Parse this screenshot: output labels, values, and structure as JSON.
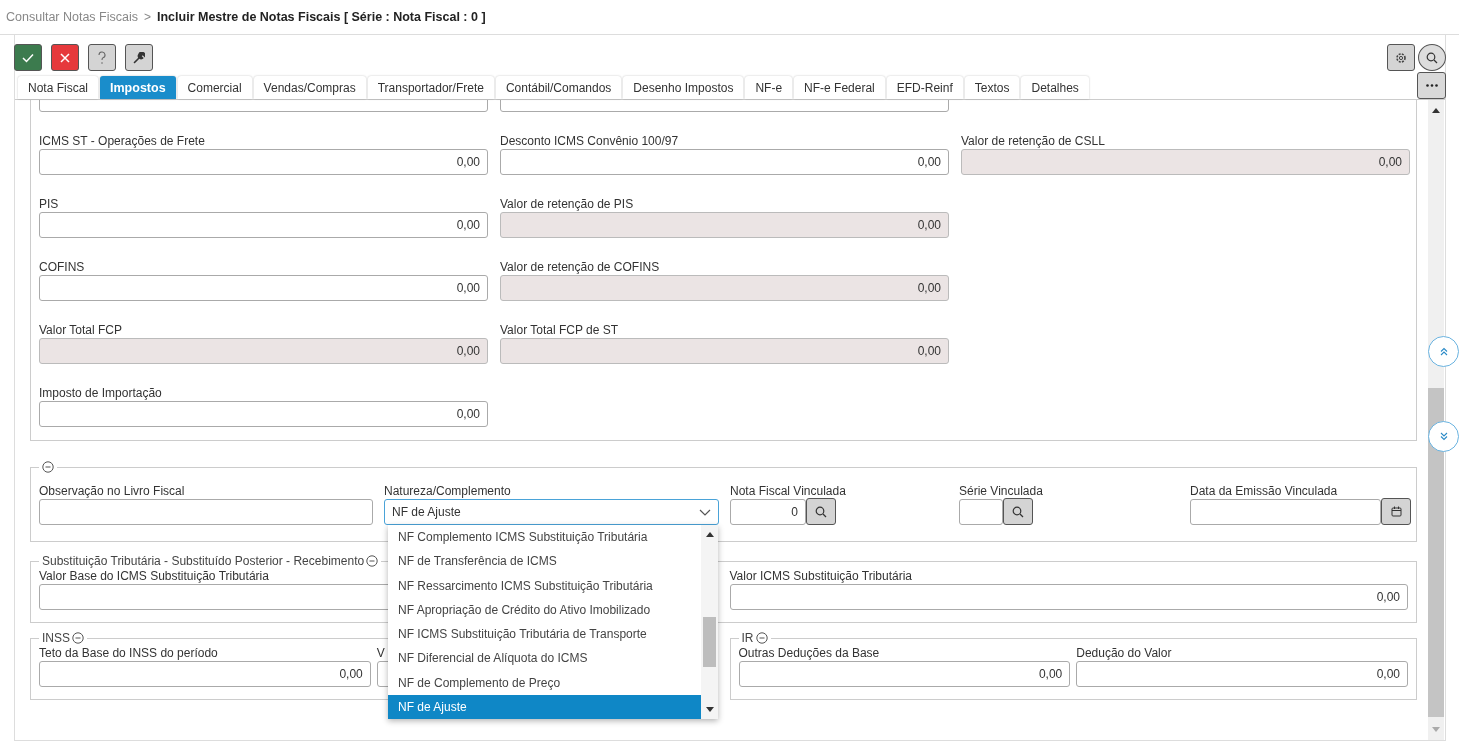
{
  "breadcrumb": {
    "parent": "Consultar Notas Fiscais",
    "separator": ">",
    "current": "Incluir Mestre de Notas Fiscais [ Série : Nota Fiscal : 0 ]"
  },
  "tabs": [
    {
      "label": "Nota Fiscal",
      "selected": false
    },
    {
      "label": "Impostos",
      "selected": true
    },
    {
      "label": "Comercial",
      "selected": false
    },
    {
      "label": "Vendas/Compras",
      "selected": false
    },
    {
      "label": "Transportador/Frete",
      "selected": false
    },
    {
      "label": "Contábil/Comandos",
      "selected": false
    },
    {
      "label": "Desenho Impostos",
      "selected": false
    },
    {
      "label": "NF-e",
      "selected": false
    },
    {
      "label": "NF-e Federal",
      "selected": false
    },
    {
      "label": "EFD-Reinf",
      "selected": false
    },
    {
      "label": "Textos",
      "selected": false
    },
    {
      "label": "Detalhes",
      "selected": false
    }
  ],
  "taxes": {
    "rows": [
      {
        "fields": [
          {
            "label": "ICMS ST - Operações de Frete",
            "value": "0,00",
            "disabled": false
          },
          {
            "label": "Desconto ICMS Convênio 100/97",
            "value": "0,00",
            "disabled": false
          },
          {
            "label": "Valor de retenção de CSLL",
            "value": "0,00",
            "disabled": true
          }
        ]
      },
      {
        "fields": [
          {
            "label": "PIS",
            "value": "0,00",
            "disabled": false
          },
          {
            "label": "Valor de retenção de PIS",
            "value": "0,00",
            "disabled": true
          }
        ]
      },
      {
        "fields": [
          {
            "label": "COFINS",
            "value": "0,00",
            "disabled": false
          },
          {
            "label": "Valor de retenção de COFINS",
            "value": "0,00",
            "disabled": true
          }
        ]
      },
      {
        "fields": [
          {
            "label": "Valor Total FCP",
            "value": "0,00",
            "disabled": true
          },
          {
            "label": "Valor Total FCP de ST",
            "value": "0,00",
            "disabled": true
          }
        ]
      },
      {
        "fields": [
          {
            "label": "Imposto de Importação",
            "value": "0,00",
            "disabled": false
          }
        ]
      }
    ]
  },
  "linked": {
    "fields": [
      {
        "kind": "text",
        "label": "Observação no Livro Fiscal"
      },
      {
        "kind": "select",
        "label": "Natureza/Complemento",
        "value": "NF de Ajuste",
        "open": true,
        "options": [
          {
            "label": "NF Complemento ICMS Substituição Tributária",
            "selected": false
          },
          {
            "label": "NF de Transferência de ICMS",
            "selected": false
          },
          {
            "label": "NF Ressarcimento ICMS Substituição Tributária",
            "selected": false
          },
          {
            "label": "NF Apropriação de Crédito do Ativo Imobilizado",
            "selected": false
          },
          {
            "label": "NF ICMS Substituição Tributária de Transporte",
            "selected": false
          },
          {
            "label": "NF Diferencial de Alíquota do ICMS",
            "selected": false
          },
          {
            "label": "NF de Complemento de Preço",
            "selected": false
          },
          {
            "label": "NF de Ajuste",
            "selected": true
          }
        ]
      },
      {
        "kind": "lookup",
        "label": "Nota Fiscal Vinculada",
        "value": "0"
      },
      {
        "kind": "lookup",
        "label": "Série Vinculada"
      },
      {
        "kind": "date",
        "label": "Data da Emissão Vinculada"
      }
    ]
  },
  "substitution": {
    "legend": "Substituição Tributária - Substituído Posterior - Recebimento",
    "fields": [
      {
        "label": "Valor Base do ICMS Substituição Tributária"
      },
      {
        "label": "Valor ICMS Substituição Tributária",
        "value": "0,00"
      }
    ]
  },
  "groups": [
    {
      "legend": "INSS",
      "fields": [
        {
          "label": "Teto da Base do INSS do período",
          "value": "0,00"
        },
        {
          "label": "V"
        }
      ]
    },
    {
      "legend": "IR",
      "fields": [
        {
          "label": "Outras Deduções da Base",
          "value": "0,00"
        },
        {
          "label": "Dedução do Valor",
          "value": "0,00"
        }
      ]
    }
  ]
}
